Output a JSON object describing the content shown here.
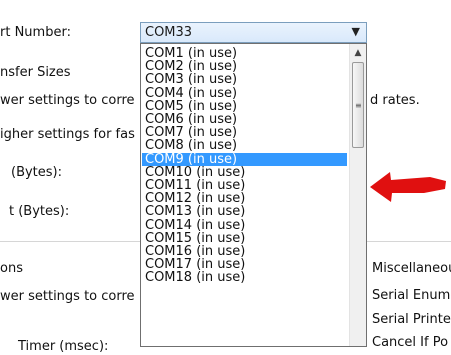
{
  "dialog": {
    "port_number_label": "rt Number:",
    "transfer_sizes_header": "nsfer Sizes",
    "lower_settings_text": "wer settings to corre",
    "rates_text": "d rates.",
    "higher_settings_text": "igher settings for fas",
    "receive_bytes_label": "(Bytes):",
    "transmit_bytes_label": "t (Bytes):",
    "options_header": "ons",
    "lower_settings_text_2": "wer settings to corre",
    "timer_label": "Timer (msec):",
    "misc_header": "Miscellaneou",
    "serial_enumerator": "Serial Enume",
    "serial_printer": "Serial Printer",
    "cancel_if_power": "Cancel If Po"
  },
  "combo": {
    "selected": "COM33",
    "options": [
      "COM1 (in use)",
      "COM2 (in use)",
      "COM3 (in use)",
      "COM4 (in use)",
      "COM5 (in use)",
      "COM6 (in use)",
      "COM7 (in use)",
      "COM8 (in use)",
      "COM9 (in use)",
      "COM10 (in use)",
      "COM11 (in use)",
      "COM12 (in use)",
      "COM13 (in use)",
      "COM14 (in use)",
      "COM15 (in use)",
      "COM16 (in use)",
      "COM17 (in use)",
      "COM18 (in use)"
    ],
    "highlighted_index": 8
  },
  "annotation": {
    "arrow_color": "#e01010"
  },
  "colors": {
    "selection": "#3399ff",
    "accent_border": "#7b9ebd"
  }
}
